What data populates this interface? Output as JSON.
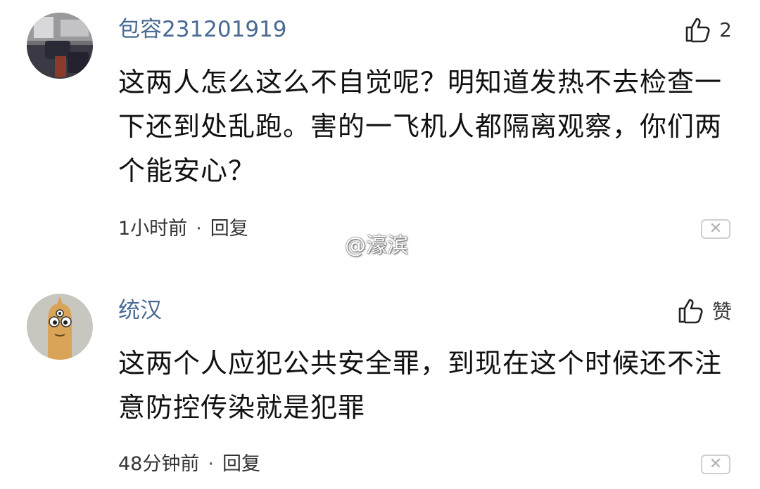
{
  "comments": [
    {
      "username": "包容231201919",
      "avatar_icon": "avatar-photo-icon",
      "like_label": "2",
      "text": "这两人怎么这么不自觉呢？明知道发热不去检查一下还到处乱跑。害的一飞机人都隔离观察，你们两个能安心？",
      "time": "1小时前",
      "separator": "·",
      "reply_label": "回复",
      "dismiss_icon": "close-icon"
    },
    {
      "username": "统汉",
      "avatar_icon": "avatar-cartoon-icon",
      "like_label": "赞",
      "text": "这两个人应犯公共安全罪，到现在这个时候还不注意防控传染就是犯罪",
      "time": "48分钟前",
      "separator": "·",
      "reply_label": "回复",
      "dismiss_icon": "close-icon"
    }
  ],
  "watermark": "@濠滨",
  "colors": {
    "username": "#4a6a93",
    "text": "#111111",
    "meta": "#333333",
    "dismiss_border": "#cfcfcf"
  }
}
